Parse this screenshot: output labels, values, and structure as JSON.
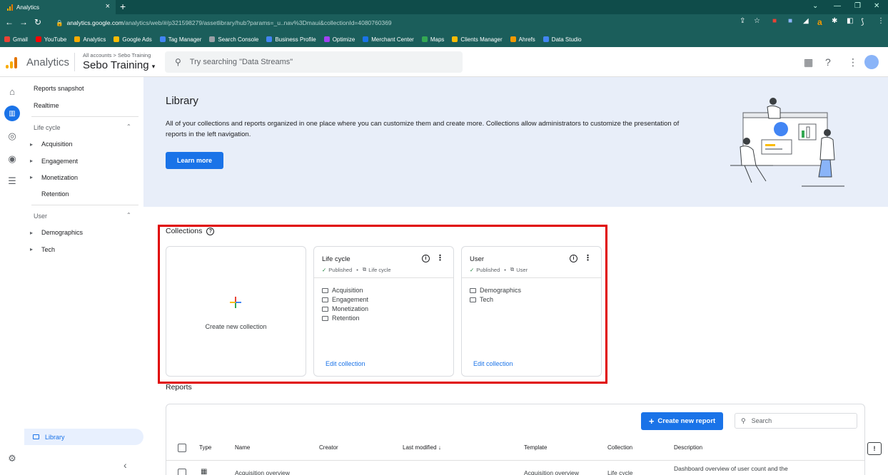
{
  "browser": {
    "tab_title": "Analytics",
    "url_host": "analytics.google.com",
    "url_path": "/analytics/web/#/p321598279/assetlibrary/hub?params=_u..nav%3Dmaui&collectionId=4080760369",
    "bookmarks": [
      "Gmail",
      "YouTube",
      "Analytics",
      "Google Ads",
      "Tag Manager",
      "Search Console",
      "Business Profile",
      "Optimize",
      "Merchant Center",
      "Maps",
      "Clients Manager",
      "Ahrefs",
      "Data Studio"
    ]
  },
  "header": {
    "app_name": "Analytics",
    "breadcrumb": "All accounts > Sebo Training",
    "property": "Sebo Training",
    "search_placeholder": "Try searching \"Data Streams\""
  },
  "sidebar": {
    "reports_snapshot": "Reports snapshot",
    "realtime": "Realtime",
    "lifecycle_section": "Life cycle",
    "lifecycle_items": [
      "Acquisition",
      "Engagement",
      "Monetization",
      "Retention"
    ],
    "user_section": "User",
    "user_items": [
      "Demographics",
      "Tech"
    ],
    "library": "Library"
  },
  "banner": {
    "title": "Library",
    "description": "All of your collections and reports organized in one place where you can customize them and create more. Collections allow administrators to customize the presentation of reports in the left navigation.",
    "learn_more": "Learn more"
  },
  "collections": {
    "title": "Collections",
    "create_label": "Create new collection",
    "cards": [
      {
        "title": "Life cycle",
        "status": "Published",
        "template": "Life cycle",
        "items": [
          "Acquisition",
          "Engagement",
          "Monetization",
          "Retention"
        ],
        "edit": "Edit collection"
      },
      {
        "title": "User",
        "status": "Published",
        "template": "User",
        "items": [
          "Demographics",
          "Tech"
        ],
        "edit": "Edit collection"
      }
    ]
  },
  "reports": {
    "title": "Reports",
    "create_button": "Create new report",
    "search_placeholder": "Search",
    "columns": [
      "Type",
      "Name",
      "Creator",
      "Last modified",
      "Template",
      "Collection",
      "Description"
    ],
    "rows": [
      {
        "name": "Acquisition overview",
        "creator": "",
        "last_modified": "",
        "template": "Acquisition overview",
        "collection": "Life cycle",
        "description": "Dashboard overview of user count and the"
      }
    ]
  },
  "colors": {
    "accent": "#1a73e8",
    "highlight": "#e00000",
    "banner": "#e8eef9"
  }
}
